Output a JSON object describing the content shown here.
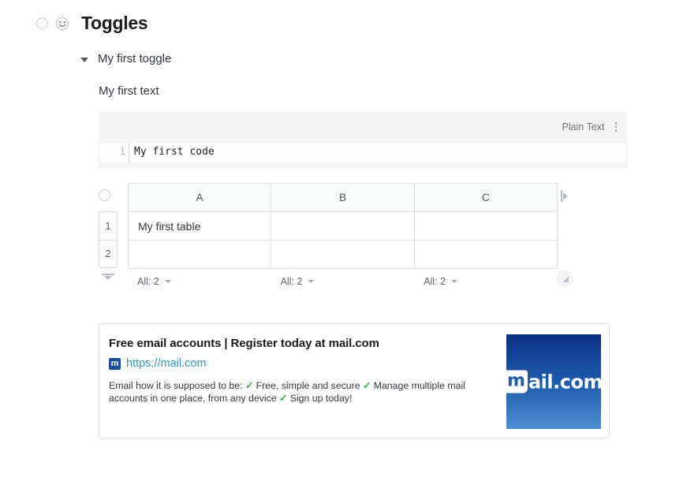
{
  "header": {
    "bullet_icon": "circle-icon",
    "emoji_icon": "smiley-face-icon",
    "title": "Toggles"
  },
  "toggle": {
    "caret_icon": "caret-down-icon",
    "label": "My first toggle",
    "content_text": "My first text"
  },
  "code_block": {
    "language": "Plain Text",
    "menu_icon": "kebab-menu-icon",
    "line_number": "1",
    "code": "My first code"
  },
  "table": {
    "bullet_icon": "circle-icon",
    "add_row_icon": "add-row-icon",
    "add_column_icon": "add-column-icon",
    "resize_icon": "resize-handle-icon",
    "columns": [
      "A",
      "B",
      "C"
    ],
    "row_headers": [
      "1",
      "2"
    ],
    "rows": [
      [
        "My first table",
        "",
        ""
      ],
      [
        "",
        "",
        ""
      ]
    ],
    "summaries": [
      {
        "label": "All: 2",
        "chevron_icon": "chevron-down-icon"
      },
      {
        "label": "All: 2",
        "chevron_icon": "chevron-down-icon"
      },
      {
        "label": "All: 2",
        "chevron_icon": "chevron-down-icon"
      }
    ]
  },
  "link_card": {
    "title": "Free email accounts | Register today at mail.com",
    "favicon_icon": "mail-com-favicon",
    "favicon_letter": "m",
    "url": "https://mail.com",
    "description_parts": [
      {
        "type": "text",
        "value": "Email how it is supposed to be: "
      },
      {
        "type": "check",
        "value": "✓"
      },
      {
        "type": "text",
        "value": " Free, simple and secure "
      },
      {
        "type": "check",
        "value": "✓"
      },
      {
        "type": "text",
        "value": " Manage multiple mail accounts in one place, from any device "
      },
      {
        "type": "check",
        "value": "✓"
      },
      {
        "type": "text",
        "value": " Sign up today!"
      }
    ],
    "thumbnail": {
      "logo_m": "m",
      "logo_rest": "ail.com",
      "gradient_top": "#0a3183",
      "gradient_bottom": "#4d8fd0"
    }
  },
  "colors": {
    "link": "#2a9cc8",
    "check": "#2bb34a",
    "code_bg": "#f5f5f5",
    "border": "#dfe3e6"
  }
}
